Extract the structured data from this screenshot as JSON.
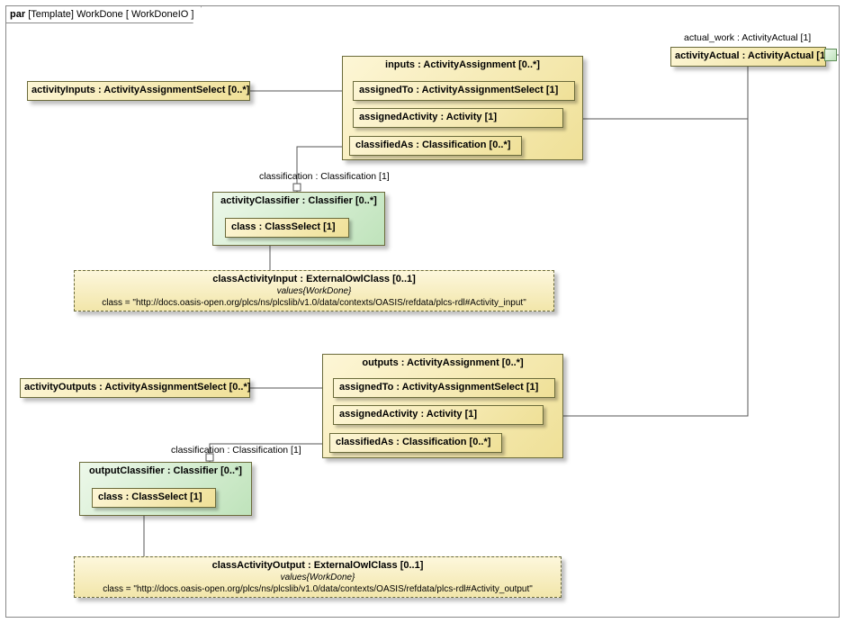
{
  "frame": {
    "kind": "par",
    "meta": "[Template]",
    "name": "WorkDone",
    "bracket": "[ WorkDoneIO ]"
  },
  "labels": {
    "actual_work": "actual_work : ActivityActual [1]",
    "classification1": "classification : Classification [1]",
    "classification2": "classification : Classification [1]"
  },
  "boxes": {
    "activityActual": "activityActual : ActivityActual [1]",
    "activityInputs": "activityInputs : ActivityAssignmentSelect [0..*]",
    "activityOutputs": "activityOutputs : ActivityAssignmentSelect [0..*]",
    "inputs_title": "inputs : ActivityAssignment [0..*]",
    "outputs_title": "outputs : ActivityAssignment [0..*]",
    "assignedTo": "assignedTo : ActivityAssignmentSelect [1]",
    "assignedActivity": "assignedActivity : Activity [1]",
    "classifiedAs": "classifiedAs : Classification [0..*]",
    "activityClassifier_title": "activityClassifier : Classifier [0..*]",
    "outputClassifier_title": "outputClassifier : Classifier [0..*]",
    "classSlot": "class : ClassSelect [1]",
    "classActivityInput_title": "classActivityInput : ExternalOwlClass [0..1]",
    "classActivityOutput_title": "classActivityOutput : ExternalOwlClass [0..1]",
    "valuesNote": "values{WorkDone}",
    "classInputVal": "class = \"http://docs.oasis-open.org/plcs/ns/plcslib/v1.0/data/contexts/OASIS/refdata/plcs-rdl#Activity_input\"",
    "classOutputVal": "class = \"http://docs.oasis-open.org/plcs/ns/plcslib/v1.0/data/contexts/OASIS/refdata/plcs-rdl#Activity_output\""
  },
  "chart_data": {
    "type": "uml-parametric-diagram",
    "frame": "par [Template] WorkDone [ WorkDoneIO ]",
    "blocks": [
      {
        "id": "activityActual",
        "label": "activityActual : ActivityActual [1]",
        "port": "actual_work : ActivityActual [1]"
      },
      {
        "id": "activityInputs",
        "label": "activityInputs : ActivityAssignmentSelect [0..*]"
      },
      {
        "id": "inputs",
        "label": "inputs : ActivityAssignment [0..*]",
        "slots": [
          "assignedTo : ActivityAssignmentSelect [1]",
          "assignedActivity : Activity [1]",
          "classifiedAs : Classification [0..*]"
        ]
      },
      {
        "id": "activityClassifier",
        "label": "activityClassifier : Classifier [0..*]",
        "color": "green",
        "slots": [
          "class : ClassSelect [1]"
        ]
      },
      {
        "id": "classActivityInput",
        "label": "classActivityInput : ExternalOwlClass [0..1]",
        "style": "dashed",
        "values": "class = \"http://docs.oasis-open.org/plcs/ns/plcslib/v1.0/data/contexts/OASIS/refdata/plcs-rdl#Activity_input\""
      },
      {
        "id": "activityOutputs",
        "label": "activityOutputs : ActivityAssignmentSelect [0..*]"
      },
      {
        "id": "outputs",
        "label": "outputs : ActivityAssignment [0..*]",
        "slots": [
          "assignedTo : ActivityAssignmentSelect [1]",
          "assignedActivity : Activity [1]",
          "classifiedAs : Classification [0..*]"
        ]
      },
      {
        "id": "outputClassifier",
        "label": "outputClassifier : Classifier [0..*]",
        "color": "green",
        "slots": [
          "class : ClassSelect [1]"
        ]
      },
      {
        "id": "classActivityOutput",
        "label": "classActivityOutput : ExternalOwlClass [0..1]",
        "style": "dashed",
        "values": "class = \"http://docs.oasis-open.org/plcs/ns/plcslib/v1.0/data/contexts/OASIS/refdata/plcs-rdl#Activity_output\""
      }
    ],
    "connectors": [
      {
        "from": "activityInputs",
        "to": "inputs.assignedTo"
      },
      {
        "from": "inputs.assignedActivity",
        "to": "activityActual",
        "via": "actual_work port"
      },
      {
        "from": "inputs.classifiedAs",
        "to": "activityClassifier",
        "label": "classification : Classification [1]",
        "bound": true
      },
      {
        "from": "activityClassifier.class",
        "to": "classActivityInput"
      },
      {
        "from": "activityOutputs",
        "to": "outputs.assignedTo"
      },
      {
        "from": "outputs.assignedActivity",
        "to": "activityActual"
      },
      {
        "from": "outputs.classifiedAs",
        "to": "outputClassifier",
        "label": "classification : Classification [1]",
        "bound": true
      },
      {
        "from": "outputClassifier.class",
        "to": "classActivityOutput"
      }
    ]
  }
}
